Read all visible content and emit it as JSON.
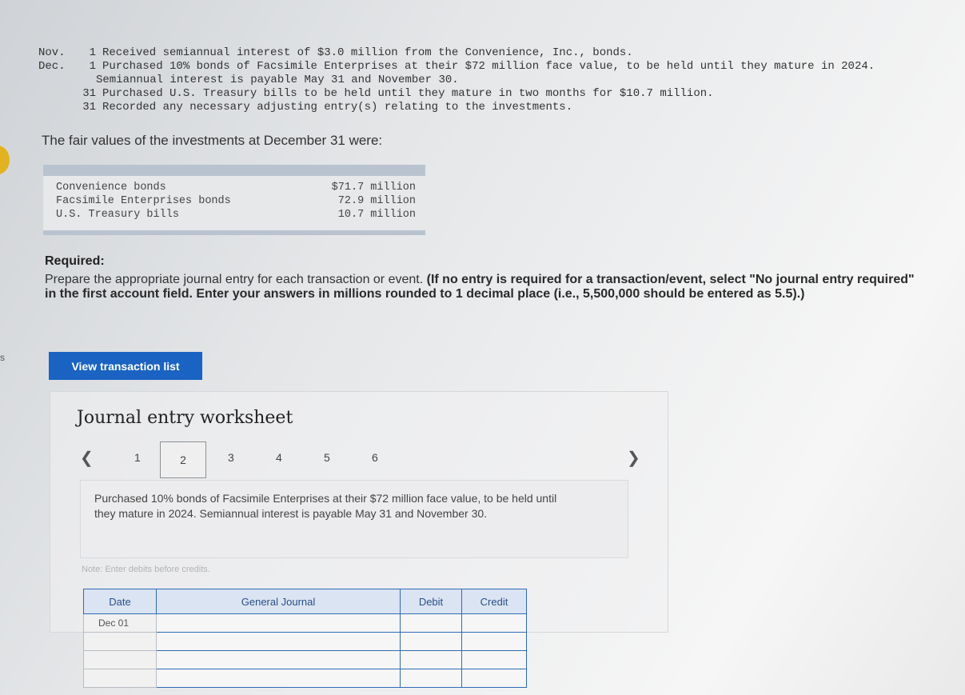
{
  "transactions": [
    {
      "month": "Nov.",
      "day": "1",
      "text": "Received semiannual interest of $3.0 million from the Convenience, Inc., bonds."
    },
    {
      "month": "Dec.",
      "day": "1",
      "text": "Purchased 10% bonds of Facsimile Enterprises at their $72 million face value, to be held until they mature in 2024."
    },
    {
      "month": "",
      "day": "",
      "text": "Semiannual interest is payable May 31 and November 30."
    },
    {
      "month": "",
      "day": "31",
      "text": "Purchased U.S. Treasury bills to be held until they mature in two months for $10.7 million."
    },
    {
      "month": "",
      "day": "31",
      "text": "Recorded any necessary adjusting entry(s) relating to the investments."
    }
  ],
  "fair_values_intro": "The fair values of the investments at December 31 were:",
  "fair_values": [
    {
      "name": "Convenience bonds",
      "value": "$71.7 million"
    },
    {
      "name": "Facsimile Enterprises bonds",
      "value": "72.9 million"
    },
    {
      "name": "U.S. Treasury bills",
      "value": "10.7 million"
    }
  ],
  "required": {
    "title": "Required:",
    "text": "Prepare the appropriate journal entry for each transaction or event.",
    "bold_text": "(If no entry is required for a transaction/event, select \"No journal entry required\" in the first account field. Enter your answers in millions rounded to 1 decimal place (i.e., 5,500,000 should be entered as 5.5).)"
  },
  "side_text": "s",
  "view_button": "View transaction list",
  "worksheet": {
    "title": "Journal entry worksheet",
    "pages": [
      "1",
      "2",
      "3",
      "4",
      "5",
      "6"
    ],
    "active_page": "2",
    "description": "Purchased 10% bonds of Facsimile Enterprises at their $72 million face value, to be held until they mature in 2024. Semiannual interest is payable May 31 and November 30.",
    "note": "Note: Enter debits before credits.",
    "columns": {
      "date": "Date",
      "account": "General Journal",
      "debit": "Debit",
      "credit": "Credit"
    },
    "first_date": "Dec 01"
  }
}
